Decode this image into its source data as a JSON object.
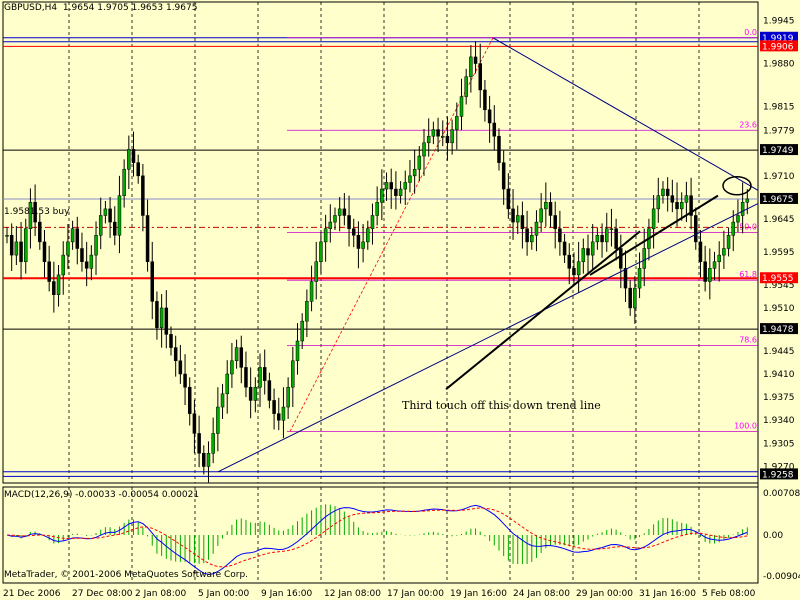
{
  "header": {
    "symbol_tf": "GBPUSD,H4",
    "ohlc": "1.9654 1.9705 1.9653 1.9675"
  },
  "order_label": "1.9581.53 buy",
  "annotation": "Third touch off this down trend line",
  "copyright": "MetaTrader, © 2001-2006 MetaQuotes Software Corp.",
  "macd_header": "MACD(12,26,9) -0.00033 -0.00054 0.00021",
  "price_axis": {
    "labels": [
      "1.9945",
      "1.9880",
      "1.9815",
      "1.9779",
      "1.9710",
      "1.9675",
      "1.9645",
      "1.9595",
      "1.9545",
      "1.9510",
      "1.9445",
      "1.9410",
      "1.9375",
      "1.9340",
      "1.9305",
      "1.9270",
      "1.9235"
    ],
    "highlight_tags": [
      {
        "text": "1.9919",
        "price": 1.9919,
        "bg": "#0000CC",
        "fg": "#FFFFFF"
      },
      {
        "text": "1.9906",
        "price": 1.9906,
        "bg": "#FF0000",
        "fg": "#FFFFFF"
      },
      {
        "text": "1.9749",
        "price": 1.9749,
        "bg": "#000000",
        "fg": "#FFFFFF"
      },
      {
        "text": "1.9675",
        "price": 1.9675,
        "bg": "#000000",
        "fg": "#FFFFFF"
      },
      {
        "text": "1.9555",
        "price": 1.9555,
        "bg": "#FF0000",
        "fg": "#FFFFFF"
      },
      {
        "text": "1.9478",
        "price": 1.9478,
        "bg": "#000000",
        "fg": "#FFFFFF"
      },
      {
        "text": "1.9258",
        "price": 1.9258,
        "bg": "#000000",
        "fg": "#FFFFFF"
      }
    ]
  },
  "macd_axis": [
    "0.00708",
    "0.00",
    "-0.00904"
  ],
  "time_axis": [
    "21 Dec 2006",
    "27 Dec 08:00",
    "2 Jan 08:00",
    "5 Jan 00:00",
    "9 Jan 16:00",
    "12 Jan 08:00",
    "17 Jan 00:00",
    "19 Jan 16:00",
    "24 Jan 08:00",
    "29 Jan 00:00",
    "31 Jan 16:00",
    "5 Feb 08:00"
  ],
  "fib_levels": [
    {
      "label": "0.0",
      "price": 1.9919
    },
    {
      "label": "23.6",
      "price": 1.9779
    },
    {
      "label": "50.0",
      "price": 1.9624
    },
    {
      "label": "61.8",
      "price": 1.9552
    },
    {
      "label": "78.6",
      "price": 1.9453
    },
    {
      "label": "100.0",
      "price": 1.9323
    }
  ],
  "colors": {
    "bg": "#FFFFCC",
    "bull": "#00AA00",
    "bear": "#000000",
    "fib": "#CC00CC",
    "blue": "#000080",
    "red": "#FF0000"
  },
  "chart_data": {
    "type": "candlestick",
    "title": "GBPUSD,H4",
    "ylim": [
      1.9245,
      1.9955
    ],
    "closes": [
      1.962,
      1.959,
      1.961,
      1.958,
      1.963,
      1.967,
      1.964,
      1.961,
      1.958,
      1.955,
      1.953,
      1.956,
      1.959,
      1.961,
      1.963,
      1.96,
      1.958,
      1.957,
      1.959,
      1.962,
      1.965,
      1.966,
      1.964,
      1.962,
      1.968,
      1.972,
      1.975,
      1.973,
      1.971,
      1.965,
      1.958,
      1.952,
      1.948,
      1.951,
      1.947,
      1.945,
      1.943,
      1.941,
      1.939,
      1.935,
      1.932,
      1.929,
      1.927,
      1.929,
      1.932,
      1.936,
      1.938,
      1.941,
      1.943,
      1.945,
      1.942,
      1.939,
      1.937,
      1.939,
      1.942,
      1.94,
      1.937,
      1.935,
      1.934,
      1.936,
      1.939,
      1.943,
      1.946,
      1.949,
      1.952,
      1.955,
      1.958,
      1.961,
      1.963,
      1.964,
      1.965,
      1.966,
      1.965,
      1.963,
      1.962,
      1.96,
      1.961,
      1.963,
      1.965,
      1.967,
      1.969,
      1.97,
      1.969,
      1.968,
      1.969,
      1.97,
      1.971,
      1.972,
      1.974,
      1.976,
      1.977,
      1.978,
      1.977,
      1.977,
      1.976,
      1.978,
      1.98,
      1.983,
      1.986,
      1.989,
      1.988,
      1.984,
      1.981,
      1.979,
      1.977,
      1.973,
      1.969,
      1.966,
      1.964,
      1.965,
      1.963,
      1.961,
      1.962,
      1.964,
      1.966,
      1.967,
      1.965,
      1.963,
      1.961,
      1.959,
      1.957,
      1.956,
      1.958,
      1.96,
      1.959,
      1.961,
      1.962,
      1.961,
      1.963,
      1.963,
      1.96,
      1.957,
      1.954,
      1.951,
      1.954,
      1.957,
      1.96,
      1.963,
      1.966,
      1.968,
      1.969,
      1.968,
      1.967,
      1.966,
      1.967,
      1.968,
      1.965,
      1.961,
      1.958,
      1.955,
      1.957,
      1.958,
      1.959,
      1.96,
      1.962,
      1.964,
      1.965,
      1.967,
      1.9675
    ]
  }
}
